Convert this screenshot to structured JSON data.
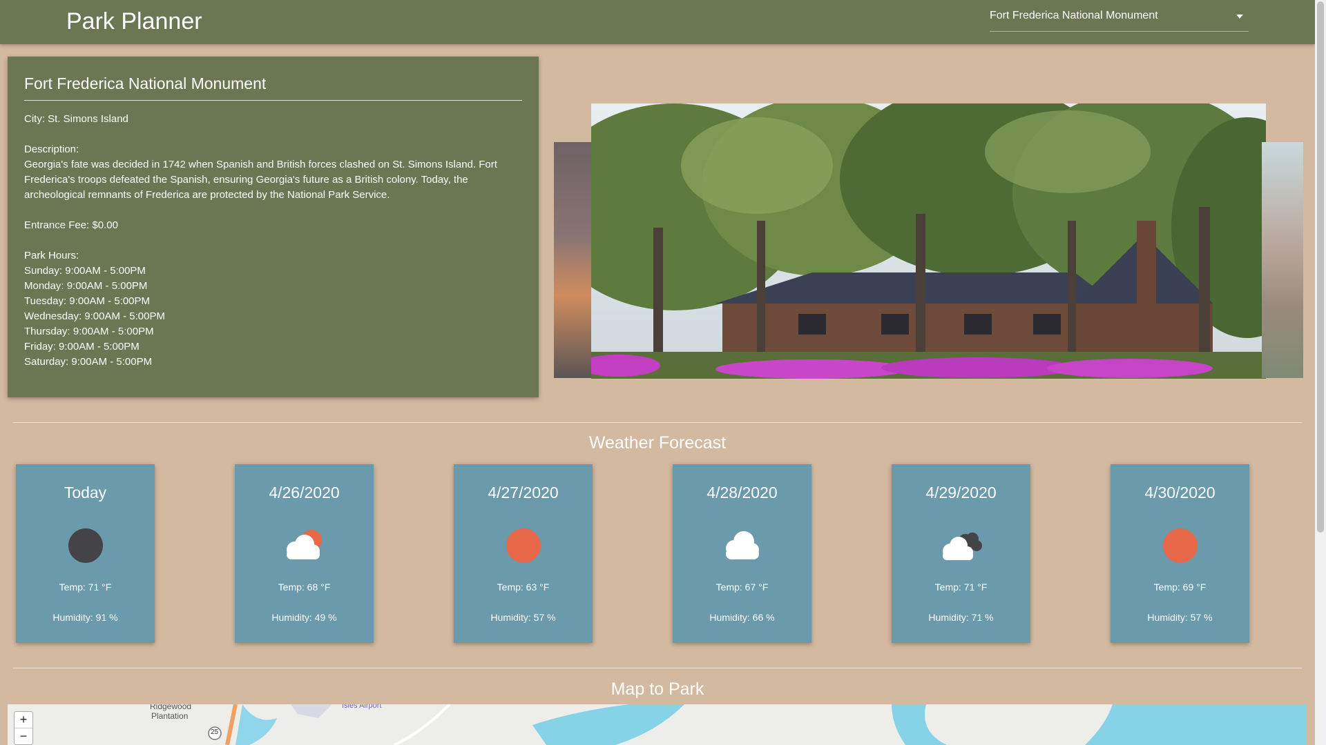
{
  "app": {
    "title": "Park Planner"
  },
  "park_select": {
    "selected": "Fort Frederica National Monument"
  },
  "park": {
    "name": "Fort Frederica National Monument",
    "city": "City: St. Simons Island",
    "description_label": "Description:",
    "description": "Georgia's fate was decided in 1742 when Spanish and British forces clashed on St. Simons Island. Fort Frederica's troops defeated the Spanish, ensuring Georgia's future as a British colony. Today, the archeological remnants of Frederica are protected by the National Park Service.",
    "fee": "Entrance Fee: $0.00",
    "hours_label": "Park Hours:",
    "hours": [
      "Sunday: 9:00AM - 5:00PM",
      "Monday: 9:00AM - 5:00PM",
      "Tuesday: 9:00AM - 5:00PM",
      "Wednesday: 9:00AM - 5:00PM",
      "Thursday: 9:00AM - 5:00PM",
      "Friday: 9:00AM - 5:00PM",
      "Saturday: 9:00AM - 5:00PM"
    ]
  },
  "weather": {
    "title": "Weather Forecast",
    "days": [
      {
        "date": "Today",
        "icon": "moon-icon",
        "temp": "Temp: 71 °F",
        "humidity": "Humidity: 91 %"
      },
      {
        "date": "4/26/2020",
        "icon": "partly-cloudy-icon",
        "temp": "Temp: 68 °F",
        "humidity": "Humidity: 49 %"
      },
      {
        "date": "4/27/2020",
        "icon": "sun-icon",
        "temp": "Temp: 63 °F",
        "humidity": "Humidity: 57 %"
      },
      {
        "date": "4/28/2020",
        "icon": "cloud-icon",
        "temp": "Temp: 67 °F",
        "humidity": "Humidity: 66 %"
      },
      {
        "date": "4/29/2020",
        "icon": "overcast-icon",
        "temp": "Temp: 71 °F",
        "humidity": "Humidity: 71 %"
      },
      {
        "date": "4/30/2020",
        "icon": "sun-icon",
        "temp": "Temp: 69 °F",
        "humidity": "Humidity: 57 %"
      }
    ]
  },
  "map": {
    "title": "Map to Park",
    "zoom_in": "+",
    "zoom_out": "−",
    "labels": [
      "Ridgewood",
      "Plantation",
      "Isles Airport",
      "25"
    ]
  },
  "colors": {
    "page_bg": "#d3b9a0",
    "navbar": "#6b7752",
    "card": "#6b7752",
    "weather_card": "#6a9aac",
    "sun": "#e8694a",
    "moon": "#444448"
  }
}
